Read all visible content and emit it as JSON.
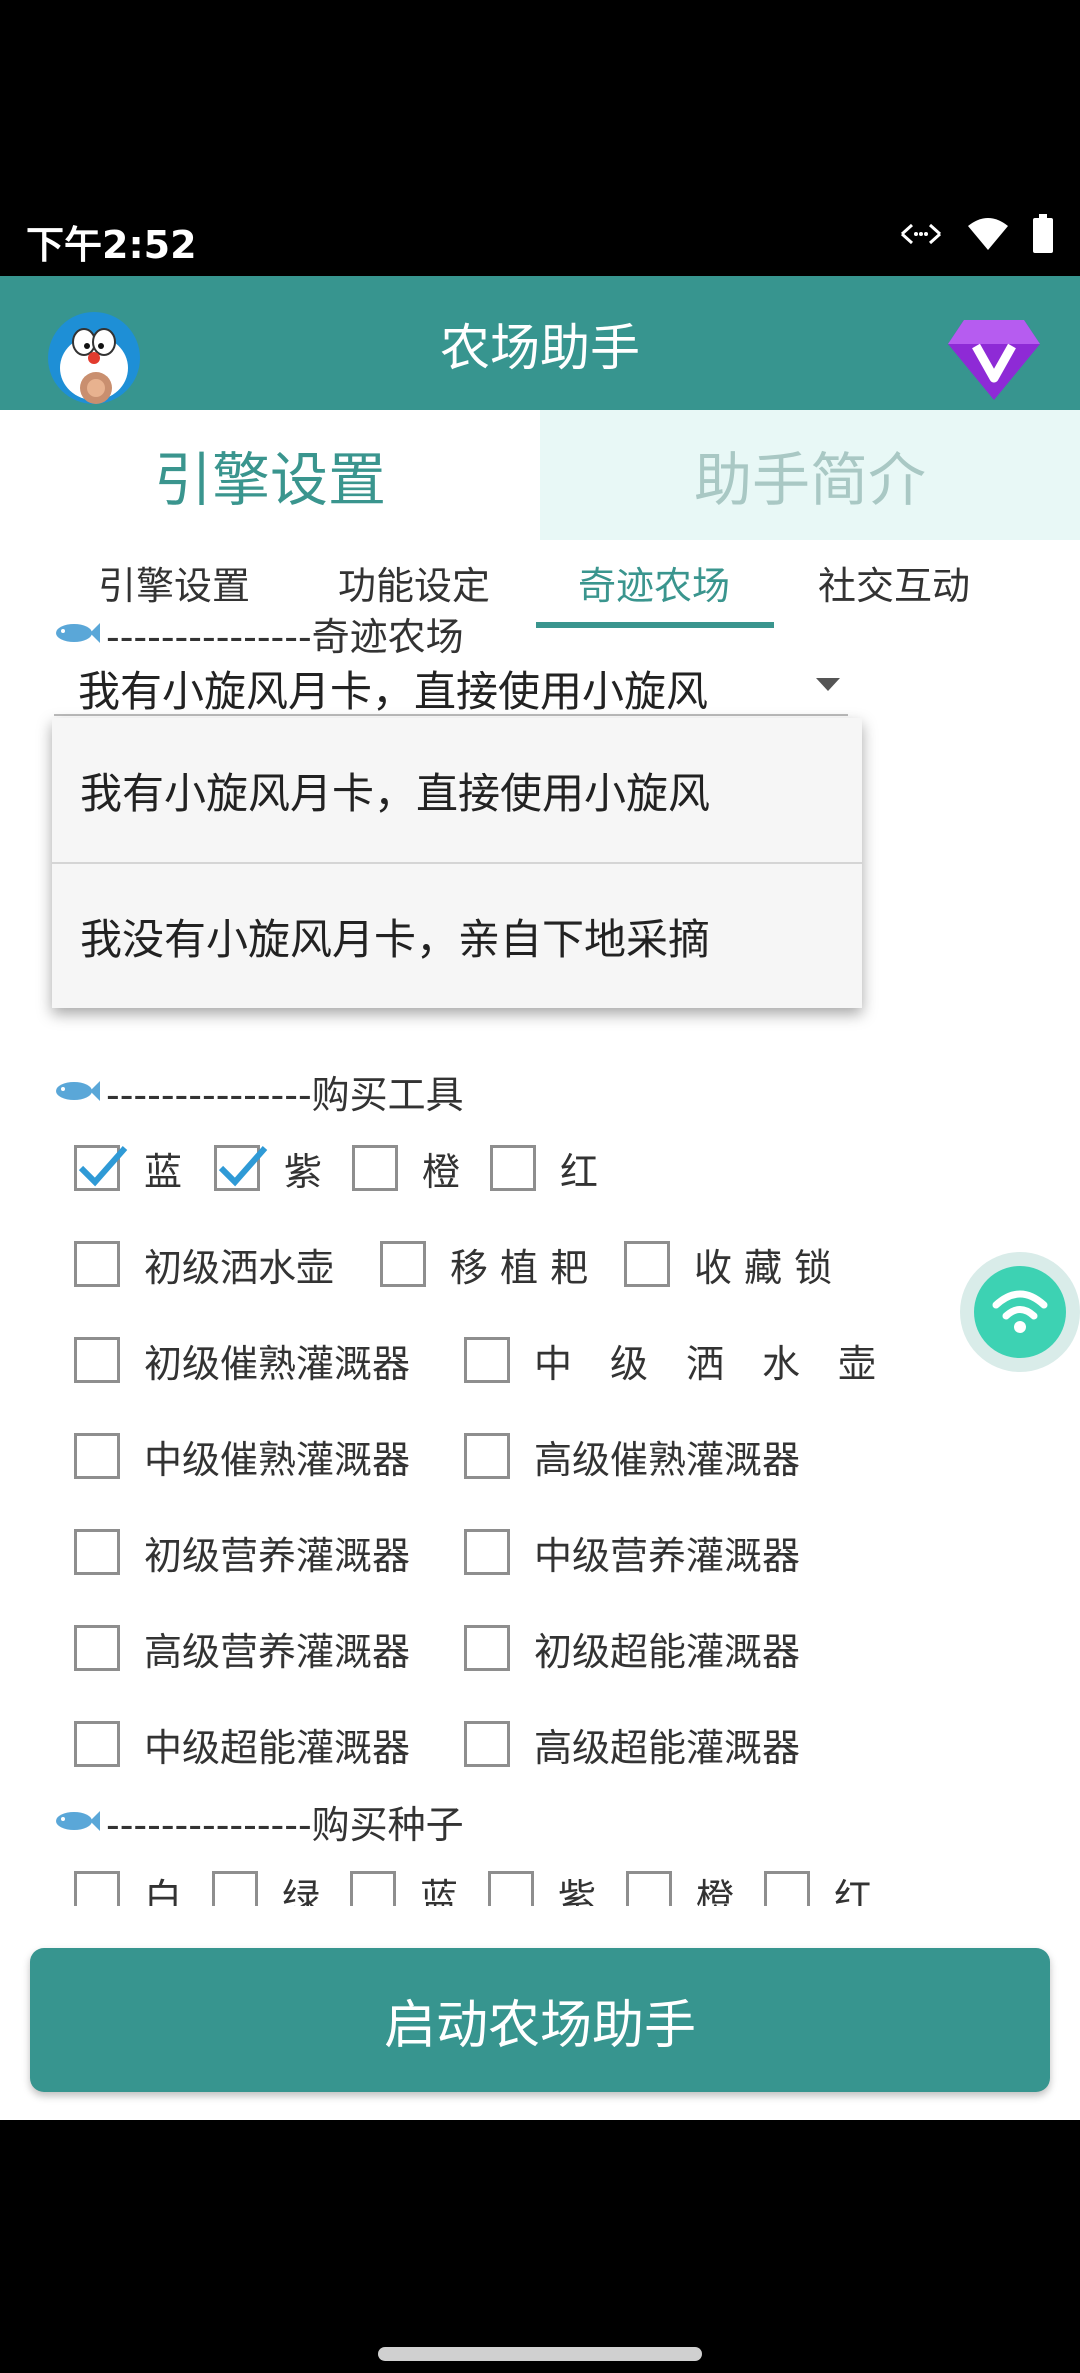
{
  "status": {
    "time": "下午2:52"
  },
  "appbar": {
    "title": "农场助手"
  },
  "top_tabs": {
    "engine": "引擎设置",
    "intro": "助手简介"
  },
  "sub_tabs": [
    "引擎设置",
    "功能设定",
    "奇迹农场",
    "社交互动"
  ],
  "miracle": {
    "section_title": "---------------奇迹农场",
    "spinner_value": "我有小旋风月卡，直接使用小旋风",
    "options": [
      "我有小旋风月卡，直接使用小旋风",
      "我没有小旋风月卡，亲自下地采摘"
    ]
  },
  "tools": {
    "section_title": "---------------购买工具",
    "row0": [
      {
        "label": "蓝",
        "checked": true
      },
      {
        "label": "紫",
        "checked": true
      },
      {
        "label": "橙",
        "checked": false
      },
      {
        "label": "红",
        "checked": false
      }
    ],
    "row1": [
      "初级洒水壶",
      "移 植 耙",
      "收 藏 锁"
    ],
    "row2": [
      "初级催熟灌溉器",
      "中　级　洒　水　壶"
    ],
    "row3": [
      "中级催熟灌溉器",
      "高级催熟灌溉器"
    ],
    "row4": [
      "初级营养灌溉器",
      "中级营养灌溉器"
    ],
    "row5": [
      "高级营养灌溉器",
      "初级超能灌溉器"
    ],
    "row6": [
      "中级超能灌溉器",
      "高级超能灌溉器"
    ]
  },
  "seeds": {
    "section_title": "---------------购买种子",
    "items": [
      "白",
      "绿",
      "蓝",
      "紫",
      "橙",
      "红"
    ]
  },
  "start_button": "启动农场助手",
  "colors": {
    "primary": "#37958f",
    "accent_green": "#3a958e",
    "tab_inactive_bg": "#e8f8f6"
  }
}
